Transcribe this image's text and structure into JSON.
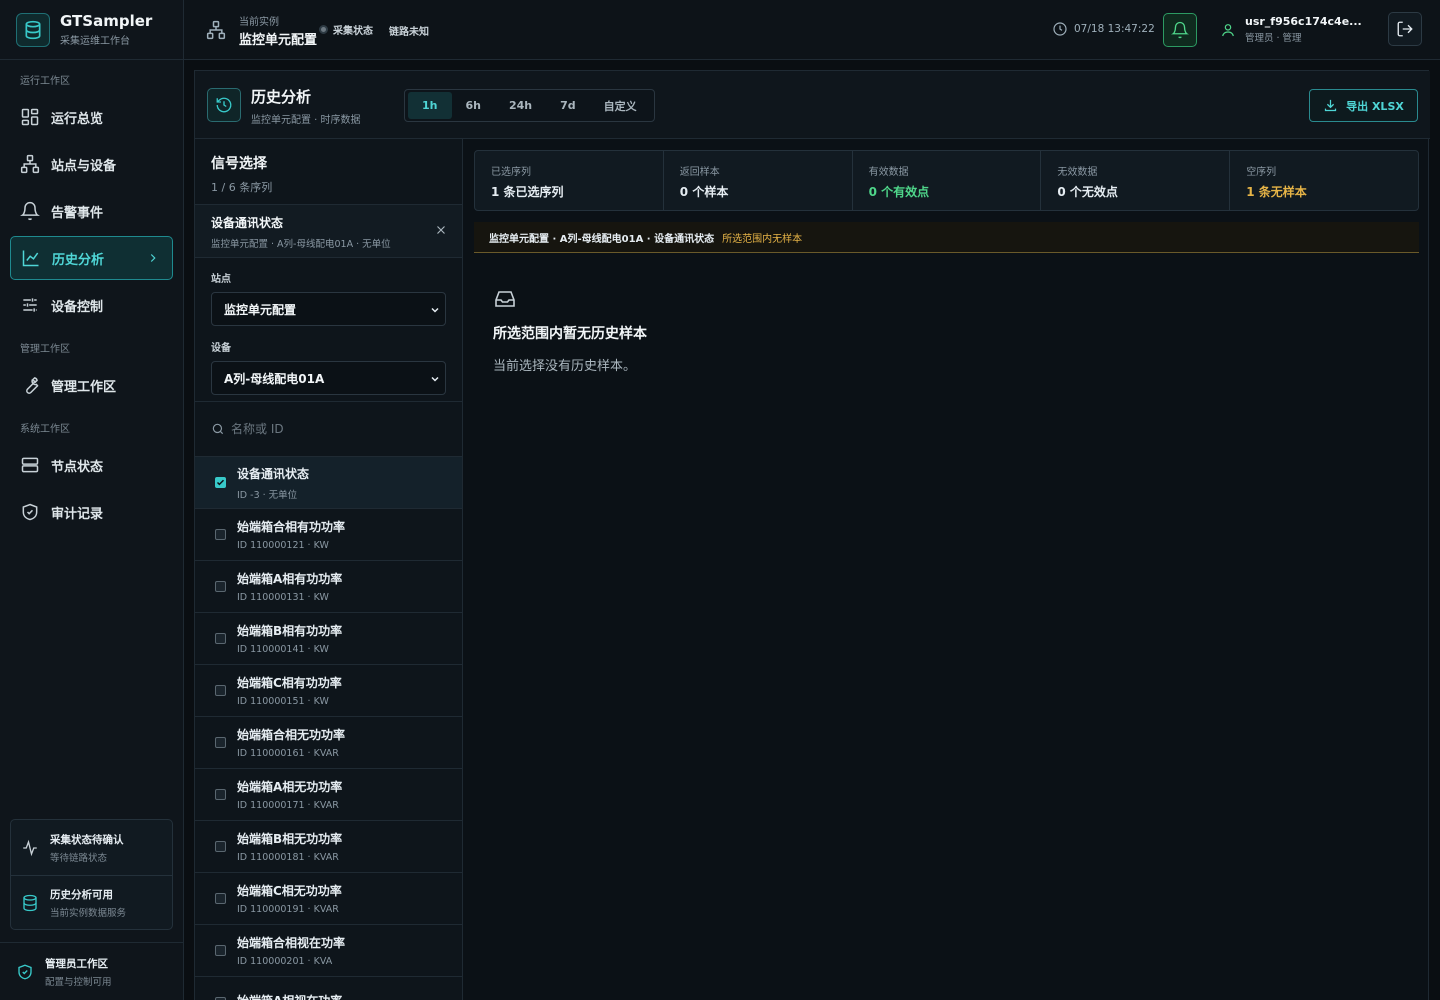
{
  "brand": {
    "name": "GTSampler",
    "subtitle": "采集运维工作台"
  },
  "sidebar": {
    "sections": [
      "运行工作区",
      "管理工作区",
      "系统工作区"
    ],
    "items": [
      {
        "label": "运行总览",
        "icon": "dashboard-grid-icon"
      },
      {
        "label": "站点与设备",
        "icon": "sitemap-icon"
      },
      {
        "label": "告警事件",
        "icon": "bell-icon"
      },
      {
        "label": "历史分析",
        "icon": "line-chart-icon",
        "active": true
      },
      {
        "label": "设备控制",
        "icon": "sliders-icon"
      },
      {
        "label": "管理工作区",
        "icon": "wrench-icon"
      },
      {
        "label": "节点状态",
        "icon": "server-icon"
      },
      {
        "label": "审计记录",
        "icon": "shield-check-icon"
      }
    ],
    "status_cards": [
      {
        "title": "采集状态待确认",
        "subtitle": "等待链路状态",
        "icon": "activity-pulse-icon"
      },
      {
        "title": "历史分析可用",
        "subtitle": "当前实例数据服务",
        "icon": "database-icon"
      }
    ],
    "footer": {
      "title": "管理员工作区",
      "subtitle": "配置与控制可用",
      "icon": "shield-check-icon"
    }
  },
  "topbar": {
    "instance_label": "当前实例",
    "instance_name": "监控单元配置",
    "collect_status": "采集状态",
    "link_status": "链路未知",
    "clock": "07/18 13:47:22",
    "user_name": "usr_f956c174c4e...",
    "user_role": "管理员 · 管理"
  },
  "page": {
    "title": "历史分析",
    "subtitle": "监控单元配置 · 时序数据",
    "ranges": [
      "1h",
      "6h",
      "24h",
      "7d",
      "自定义"
    ],
    "active_range": "1h",
    "export_label": "导出 XLSX"
  },
  "signals": {
    "title": "信号选择",
    "count": "1 / 6 条序列",
    "selected": {
      "name": "设备通讯状态",
      "path": "监控单元配置 · A列-母线配电01A · 无单位"
    },
    "site_label": "站点",
    "site_value": "监控单元配置",
    "device_label": "设备",
    "device_value": "A列-母线配电01A",
    "search_placeholder": "名称或 ID",
    "rows": [
      {
        "name": "设备通讯状态",
        "meta": "ID -3 · 无单位",
        "checked": true
      },
      {
        "name": "始端箱合相有功功率",
        "meta": "ID 110000121 · KW",
        "checked": false
      },
      {
        "name": "始端箱A相有功功率",
        "meta": "ID 110000131 · KW",
        "checked": false
      },
      {
        "name": "始端箱B相有功功率",
        "meta": "ID 110000141 · KW",
        "checked": false
      },
      {
        "name": "始端箱C相有功功率",
        "meta": "ID 110000151 · KW",
        "checked": false
      },
      {
        "name": "始端箱合相无功功率",
        "meta": "ID 110000161 · KVAR",
        "checked": false
      },
      {
        "name": "始端箱A相无功功率",
        "meta": "ID 110000171 · KVAR",
        "checked": false
      },
      {
        "name": "始端箱B相无功功率",
        "meta": "ID 110000181 · KVAR",
        "checked": false
      },
      {
        "name": "始端箱C相无功功率",
        "meta": "ID 110000191 · KVAR",
        "checked": false
      },
      {
        "name": "始端箱合相视在功率",
        "meta": "ID 110000201 · KVA",
        "checked": false
      },
      {
        "name": "始端箱A相视在功率",
        "meta": "",
        "checked": false
      }
    ]
  },
  "stats": [
    {
      "label": "已选序列",
      "value": "1 条已选序列",
      "color": "#e6edf2"
    },
    {
      "label": "返回样本",
      "value": "0 个样本",
      "color": "#e6edf2"
    },
    {
      "label": "有效数据",
      "value": "0 个有效点",
      "color": "#4fd68a"
    },
    {
      "label": "无效数据",
      "value": "0 个无效点",
      "color": "#e6edf2"
    },
    {
      "label": "空序列",
      "value": "1 条无样本",
      "color": "#e6b447"
    }
  ],
  "banner": {
    "path": "监控单元配置 · A列-母线配电01A · 设备通讯状态",
    "warning": "所选范围内无样本"
  },
  "empty_state": {
    "title": "所选范围内暂无历史样本",
    "message": "当前选择没有历史样本。"
  },
  "colors": {
    "accent": "#38c9c9",
    "success": "#4fd68a",
    "warning": "#e6b447",
    "background": "#0a0e12"
  }
}
